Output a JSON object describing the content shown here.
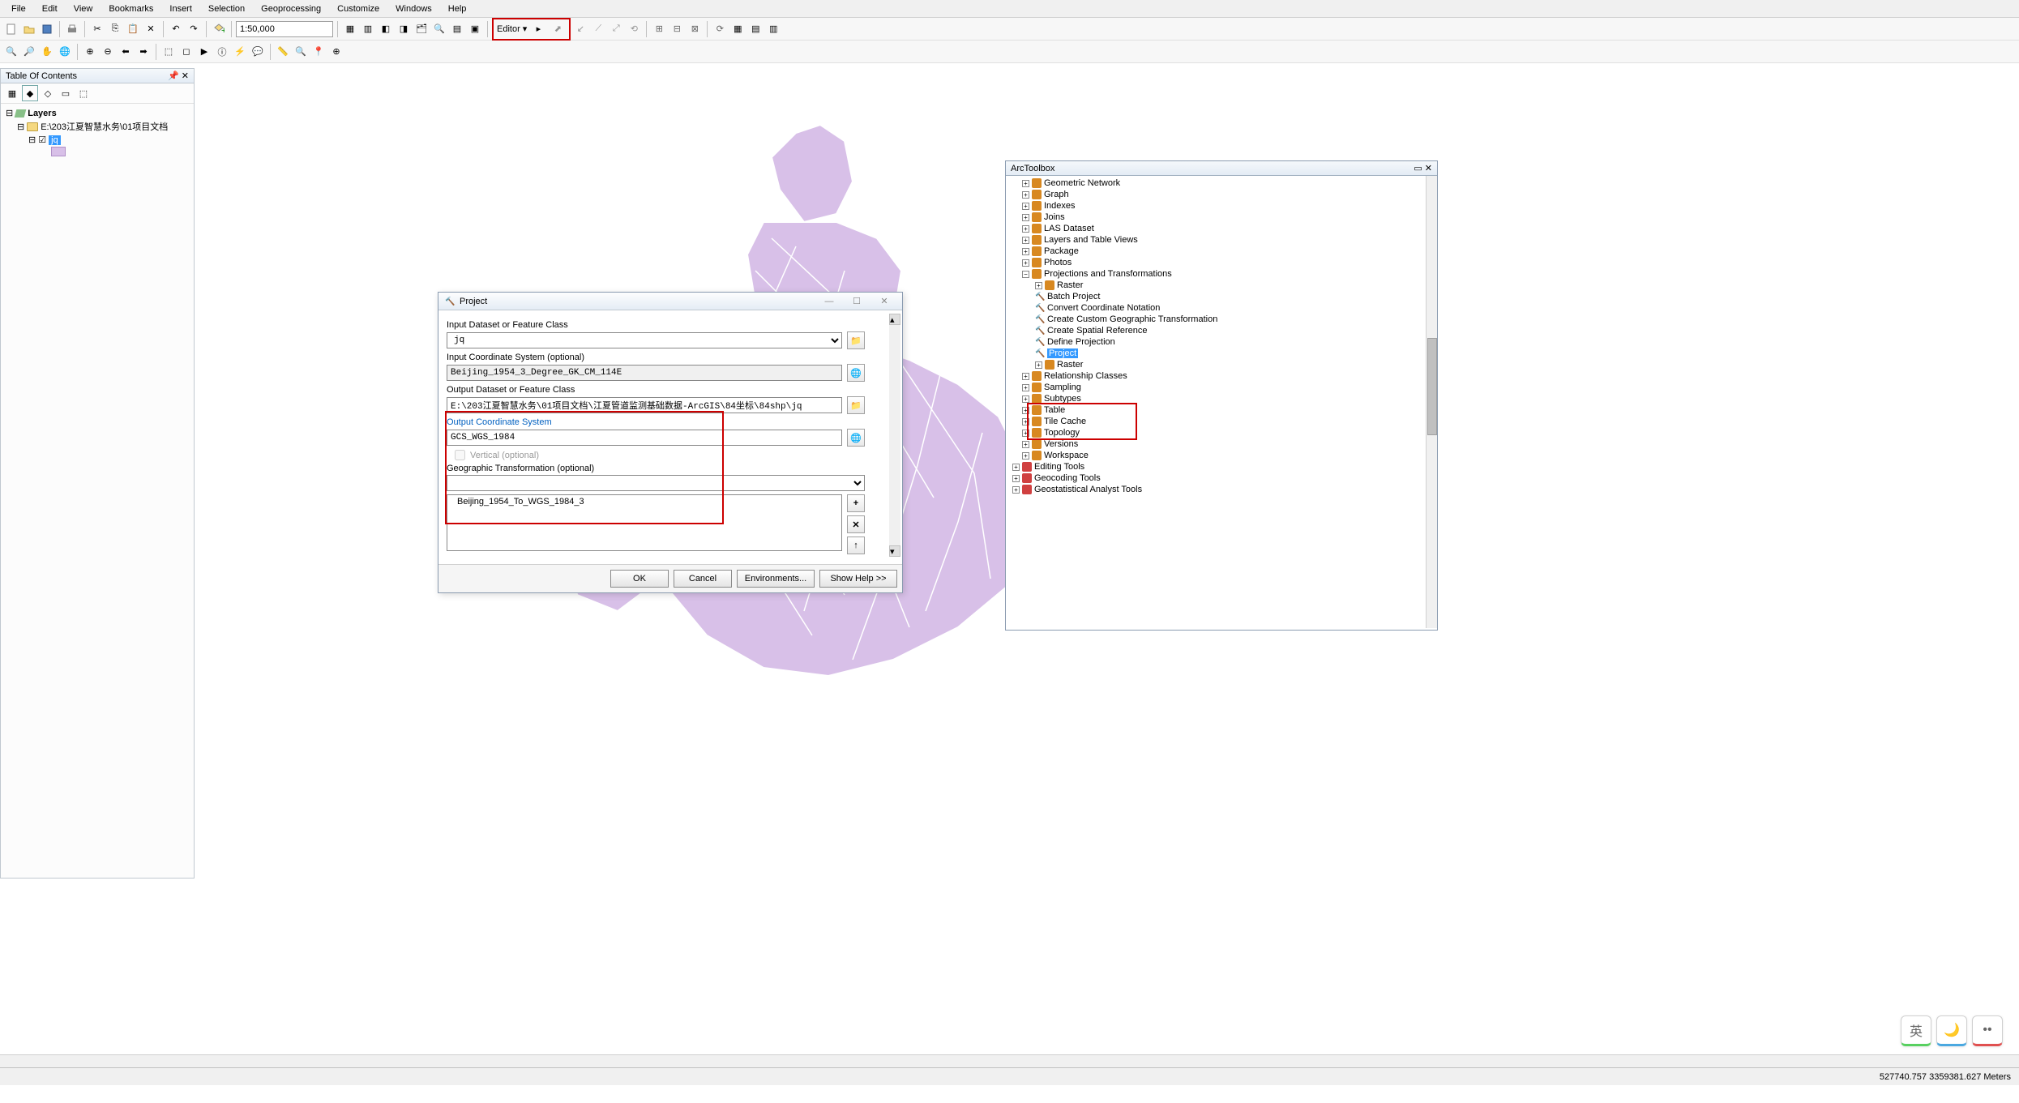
{
  "menu": [
    "File",
    "Edit",
    "View",
    "Bookmarks",
    "Insert",
    "Selection",
    "Geoprocessing",
    "Customize",
    "Windows",
    "Help"
  ],
  "scale": "1:50,000",
  "editor_label": "Editor",
  "toc": {
    "title": "Table Of Contents",
    "root": "Layers",
    "path": "E:\\203江夏智慧水务\\01项目文档",
    "layer": "jq"
  },
  "toolbox": {
    "title": "ArcToolbox",
    "items": [
      "Geometric Network",
      "Graph",
      "Indexes",
      "Joins",
      "LAS Dataset",
      "Layers and Table Views",
      "Package",
      "Photos"
    ],
    "proj_root": "Projections and Transformations",
    "proj_sub": "Raster",
    "proj_tools": [
      "Batch Project",
      "Convert Coordinate Notation",
      "Create Custom Geographic Transformation",
      "Create Spatial Reference",
      "Define Projection"
    ],
    "proj_sel": "Project",
    "proj_after": "Raster",
    "items2": [
      "Relationship Classes",
      "Sampling",
      "Subtypes",
      "Table",
      "Tile Cache",
      "Topology",
      "Versions",
      "Workspace"
    ],
    "groups": [
      "Editing Tools",
      "Geocoding Tools",
      "Geostatistical Analyst Tools"
    ]
  },
  "dialog": {
    "title": "Project",
    "labels": {
      "input_ds": "Input Dataset or Feature Class",
      "input_cs": "Input Coordinate System (optional)",
      "output_ds": "Output Dataset or Feature Class",
      "output_cs": "Output Coordinate System",
      "vertical": "Vertical (optional)",
      "geo_trans": "Geographic Transformation (optional)"
    },
    "values": {
      "input_ds": "jq",
      "input_cs": "Beijing_1954_3_Degree_GK_CM_114E",
      "output_ds": "E:\\203江夏智慧水务\\01项目文档\\江夏管道监测基础数据-ArcGIS\\84坐标\\84shp\\jq",
      "output_cs": "GCS_WGS_1984",
      "trans_item": "Beijing_1954_To_WGS_1984_3"
    },
    "buttons": {
      "ok": "OK",
      "cancel": "Cancel",
      "env": "Environments...",
      "help": "Show Help >>"
    }
  },
  "status": {
    "coords": "527740.757 3359381.627 Meters"
  },
  "ime": {
    "lang": "英",
    "moon": "🌙",
    "dots": "••"
  }
}
